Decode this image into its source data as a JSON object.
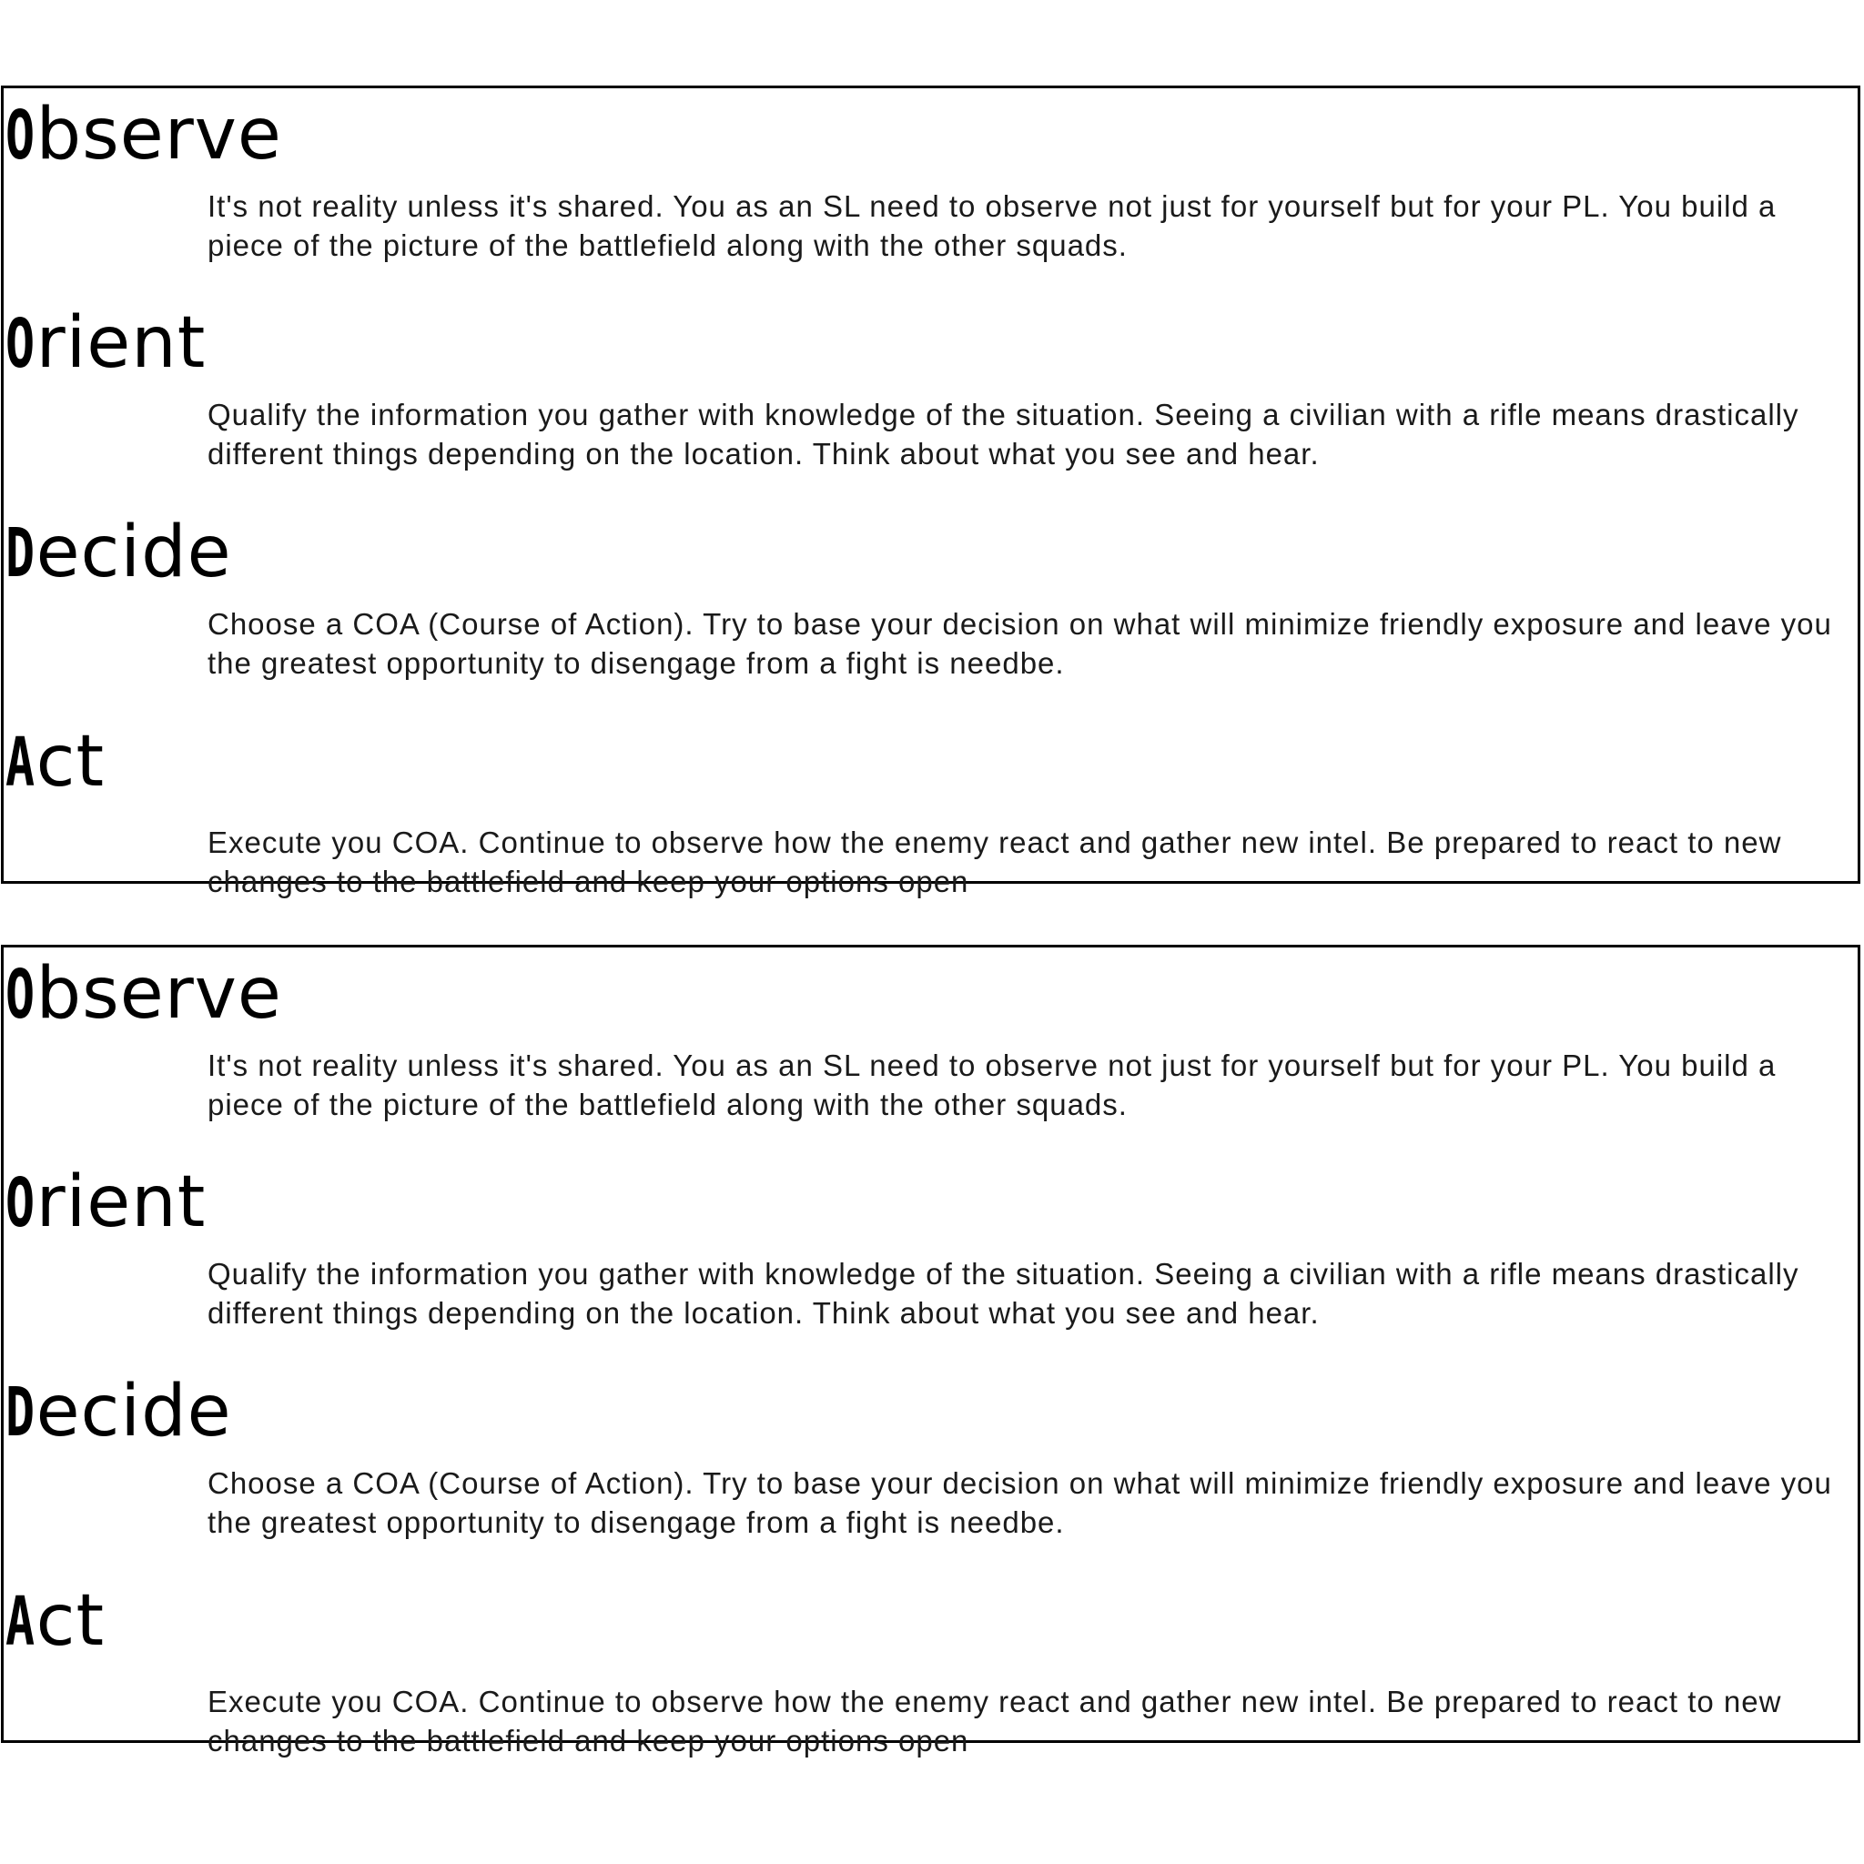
{
  "panels": [
    {
      "sections": [
        {
          "heading_initial": "O",
          "heading_rest": "bserve",
          "text": "It's not reality unless it's shared. You as an SL need to observe not just for yourself but for your PL. You build a piece of the picture of the battlefield along with the other squads."
        },
        {
          "heading_initial": "O",
          "heading_rest": "rient",
          "text": "Qualify the information you gather with knowledge of the situation. Seeing a civilian with a rifle means drastically different things depending on the location. Think about what you see and hear."
        },
        {
          "heading_initial": "D",
          "heading_rest": "ecide",
          "text": "Choose a COA (Course of Action). Try to base your decision on what will minimize friendly exposure and leave you the greatest opportunity to disengage from a fight is needbe."
        },
        {
          "heading_initial": "A",
          "heading_rest": "ct",
          "text": "Execute you COA. Continue to observe how the enemy react and gather new intel. Be prepared to react to new changes to the battlefield and keep your options open"
        }
      ]
    },
    {
      "sections": [
        {
          "heading_initial": "O",
          "heading_rest": "bserve",
          "text": "It's not reality unless it's shared. You as an SL need to observe not just for yourself but for your PL. You build a piece of the picture of the battlefield along with the other squads."
        },
        {
          "heading_initial": "O",
          "heading_rest": "rient",
          "text": "Qualify the information you gather with knowledge of the situation. Seeing a civilian with a rifle means drastically different things depending on the location. Think about what you see and hear."
        },
        {
          "heading_initial": "D",
          "heading_rest": "ecide",
          "text": "Choose a COA (Course of Action). Try to base your decision on what will minimize friendly exposure and leave you the greatest opportunity to disengage from a fight is needbe."
        },
        {
          "heading_initial": "A",
          "heading_rest": "ct",
          "text": "Execute you COA. Continue to observe how the enemy react and gather new intel. Be prepared to react to new changes to the battlefield and keep your options open"
        }
      ]
    }
  ]
}
